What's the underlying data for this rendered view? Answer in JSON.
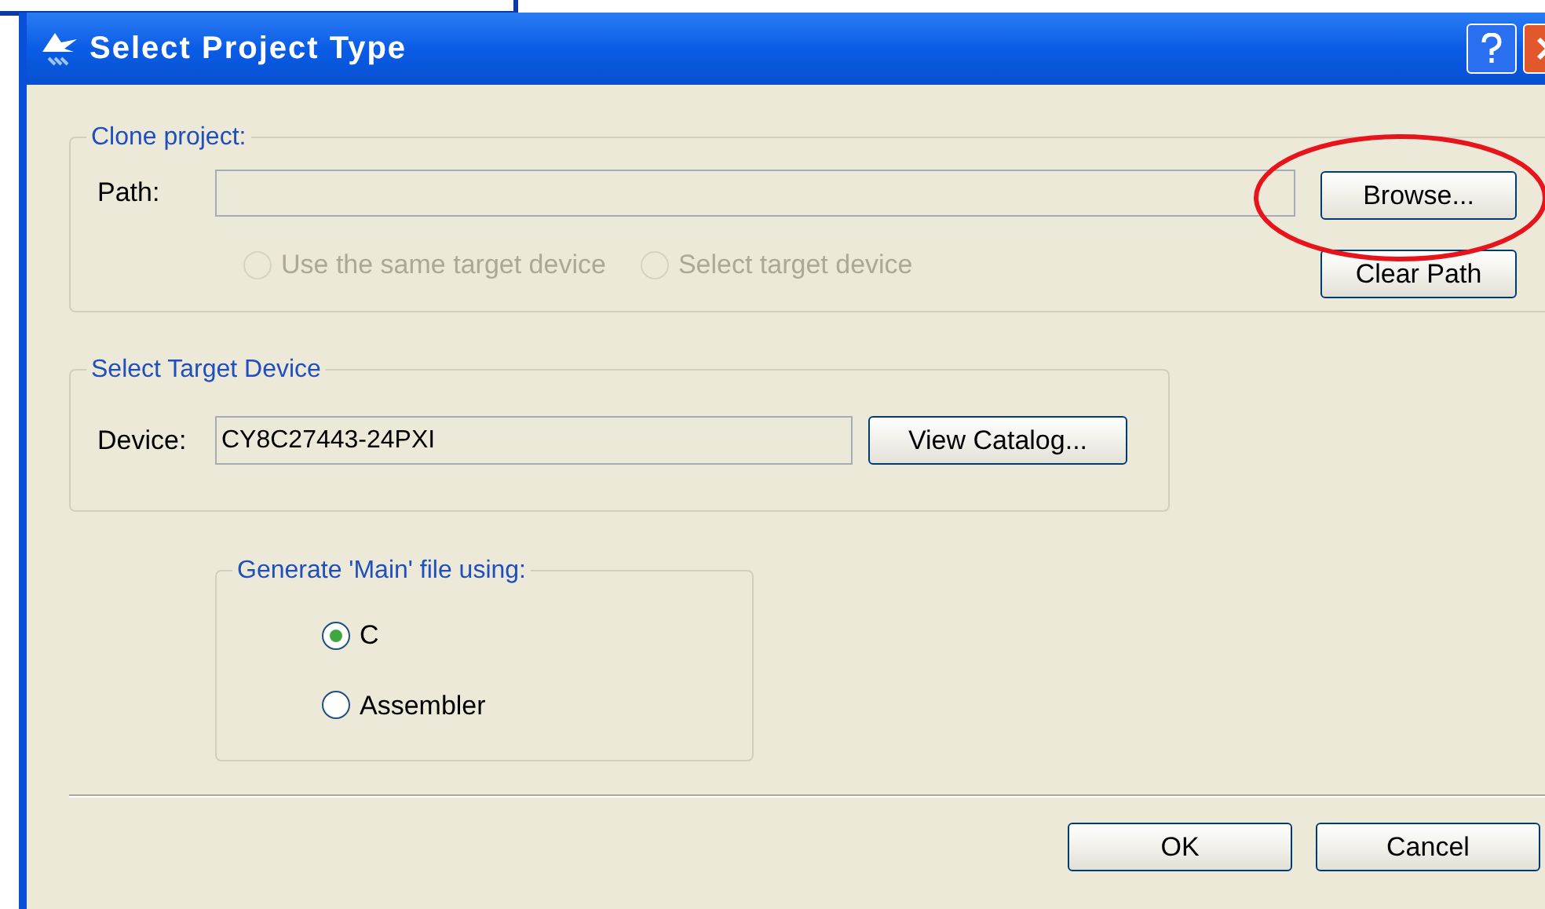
{
  "window": {
    "title": "Select Project Type"
  },
  "clone_project": {
    "legend": "Clone project:",
    "path_label": "Path:",
    "browse_button": "Browse...",
    "clear_button": "Clear Path",
    "highlighted": true,
    "options": [
      {
        "label": "Use the same target device",
        "selected": false,
        "disabled": true
      },
      {
        "label": "Select target device",
        "selected": false,
        "disabled": true
      }
    ]
  },
  "target_device": {
    "legend": "Select Target Device",
    "device_label": "Device:",
    "device_value": "CY8C27443-24PXI",
    "catalog_button": "View Catalog..."
  },
  "generate_main": {
    "legend": "Generate 'Main' file using:",
    "options": [
      {
        "label": "C",
        "selected": true,
        "disabled": false
      },
      {
        "label": "Assembler",
        "selected": false,
        "disabled": false
      }
    ]
  },
  "buttons": [
    "OK",
    "Cancel"
  ]
}
